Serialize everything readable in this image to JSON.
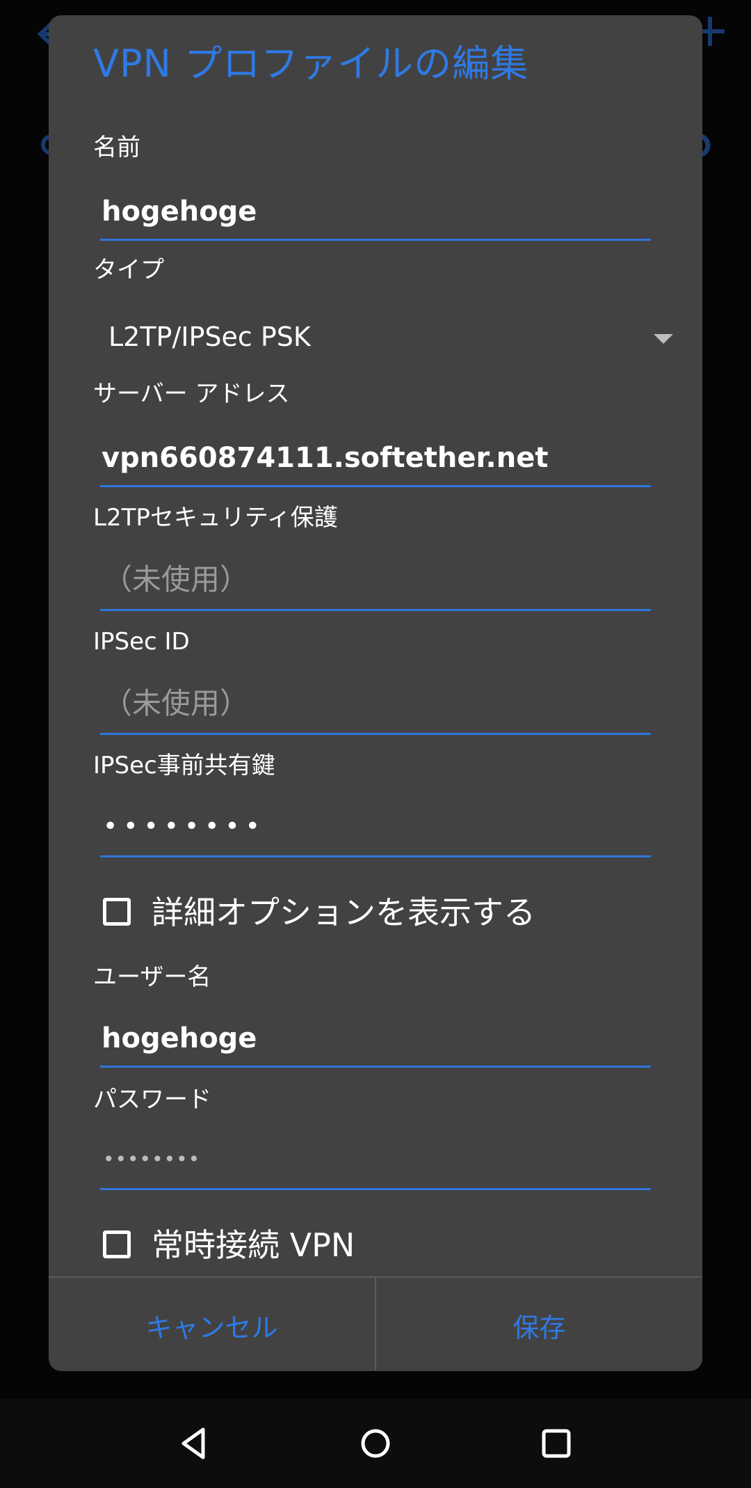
{
  "dialog": {
    "title": "VPN プロファイルの編集",
    "fields": {
      "name": {
        "label": "名前",
        "value": "hogehoge"
      },
      "type": {
        "label": "タイプ",
        "value": "L2TP/IPSec PSK"
      },
      "server": {
        "label": "サーバー アドレス",
        "value": "vpn660874111.softether.net"
      },
      "l2tp_secret": {
        "label": "L2TPセキュリティ保護",
        "placeholder": "（未使用）"
      },
      "ipsec_id": {
        "label": "IPSec ID",
        "placeholder": "（未使用）"
      },
      "ipsec_psk": {
        "label": "IPSec事前共有鍵",
        "masked": "••••••••"
      },
      "username": {
        "label": "ユーザー名",
        "value": "hogehoge"
      },
      "password": {
        "label": "パスワード",
        "masked": "••••••••"
      }
    },
    "show_advanced": {
      "label": "詳細オプションを表示する",
      "checked": false
    },
    "always_on": {
      "label": "常時接続 VPN",
      "checked": false
    },
    "buttons": {
      "cancel": "キャンセル",
      "save": "保存"
    }
  },
  "background_icons": [
    "back-arrow-icon",
    "add-icon",
    "gear-icon"
  ],
  "nav": [
    "back-icon",
    "home-icon",
    "recents-icon"
  ],
  "colors": {
    "accent": "#2f7ae5",
    "dialog_bg": "#424242"
  }
}
